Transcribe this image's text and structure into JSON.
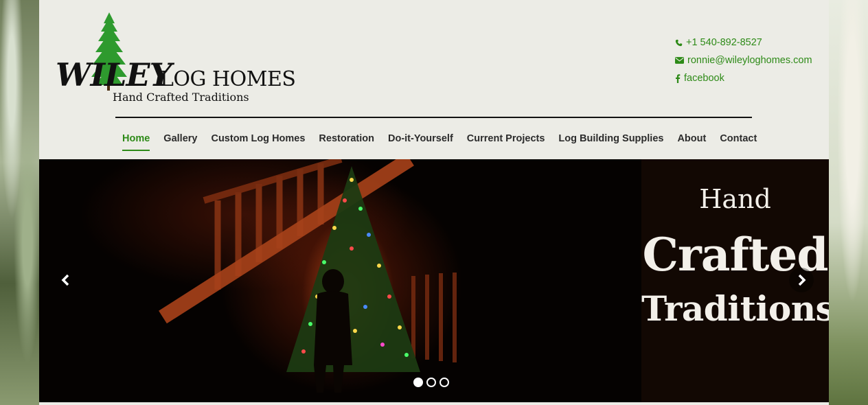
{
  "brand": {
    "name_main": "WILEY",
    "name_rest": "LOG HOMES",
    "tagline": "Hand Crafted Traditions"
  },
  "contact": {
    "phone": "+1 540-892-8527",
    "email": "ronnie@wileyloghomes.com",
    "facebook": "facebook"
  },
  "nav": {
    "items": [
      {
        "label": "Home",
        "active": true
      },
      {
        "label": "Gallery"
      },
      {
        "label": "Custom Log Homes"
      },
      {
        "label": "Restoration"
      },
      {
        "label": "Do-it-Yourself"
      },
      {
        "label": "Current Projects"
      },
      {
        "label": "Log Building Supplies"
      },
      {
        "label": "About"
      },
      {
        "label": "Contact"
      }
    ]
  },
  "slider": {
    "panel_line1": "Hand",
    "panel_line2": "Crafted",
    "panel_line3": "Traditions",
    "slide_count": 3,
    "active_slide": 1
  },
  "colors": {
    "accent": "#2d8a17",
    "header_bg": "#ecece6",
    "text": "#2b2b2b"
  },
  "icons": [
    "phone-icon",
    "envelope-icon",
    "facebook-icon",
    "chevron-left-icon",
    "chevron-right-icon",
    "pine-tree-logo"
  ]
}
